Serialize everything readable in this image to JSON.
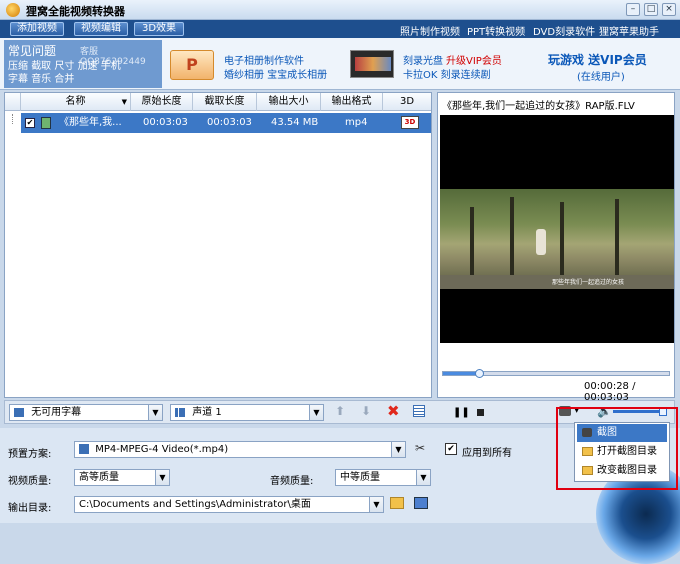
{
  "window": {
    "title": "狸窝全能视频转换器"
  },
  "menubar": {
    "buttons": [
      "添加视频",
      "视频编辑",
      "3D效果"
    ],
    "links": [
      "照片制作视频",
      "PPT转换视频",
      "DVD刻录软件",
      "狸窝苹果助手"
    ]
  },
  "faq": {
    "title": "常见问题",
    "qq": "客服QQ876292449",
    "tags": [
      "压缩",
      "截取",
      "尺寸",
      "加速",
      "手机",
      "字幕",
      "音乐",
      "合并"
    ]
  },
  "ads": {
    "photo_line1": "电子相册制作软件",
    "photo_line2": "婚纱相册  宝宝成长相册",
    "burn_line1a": "刻录光盘",
    "burn_line1b": "升级VIP会员",
    "burn_line2": "卡拉OK  刻录连续剧",
    "game_line1": "玩游戏  送VIP会员",
    "game_line2": "(在线用户)"
  },
  "table": {
    "columns": [
      "名称",
      "原始长度",
      "截取长度",
      "输出大小",
      "输出格式",
      "3D"
    ],
    "rows": [
      {
        "name": "《那些年,我...",
        "orig": "00:03:03",
        "cut": "00:03:03",
        "size": "43.54 MB",
        "format": "mp4",
        "badge": "3D"
      }
    ]
  },
  "preview": {
    "title": "《那些年,我们一起追过的女孩》RAP版.FLV",
    "time": "00:00:28 / 00:03:03",
    "progress_fraction": 0.16,
    "video_caption": "那些年我们一起追过的女孩"
  },
  "controls": {
    "subtitle": "无可用字幕",
    "audio": "声道 1"
  },
  "settings": {
    "preset_label": "预置方案:",
    "preset_value": "MP4-MPEG-4 Video(*.mp4)",
    "apply_all": "应用到所有",
    "video_quality_label": "视频质量:",
    "video_quality_value": "高等质量",
    "audio_quality_label": "音频质量:",
    "audio_quality_value": "中等质量",
    "output_label": "输出目录:",
    "output_value": "C:\\Documents and Settings\\Administrator\\桌面"
  },
  "popup": {
    "items": [
      "截图",
      "打开截图目录",
      "改变截图目录"
    ]
  },
  "colors": {
    "accent": "#3c78c6",
    "highlight_frame": "#e00010",
    "menubar": "#1e4f8e"
  }
}
